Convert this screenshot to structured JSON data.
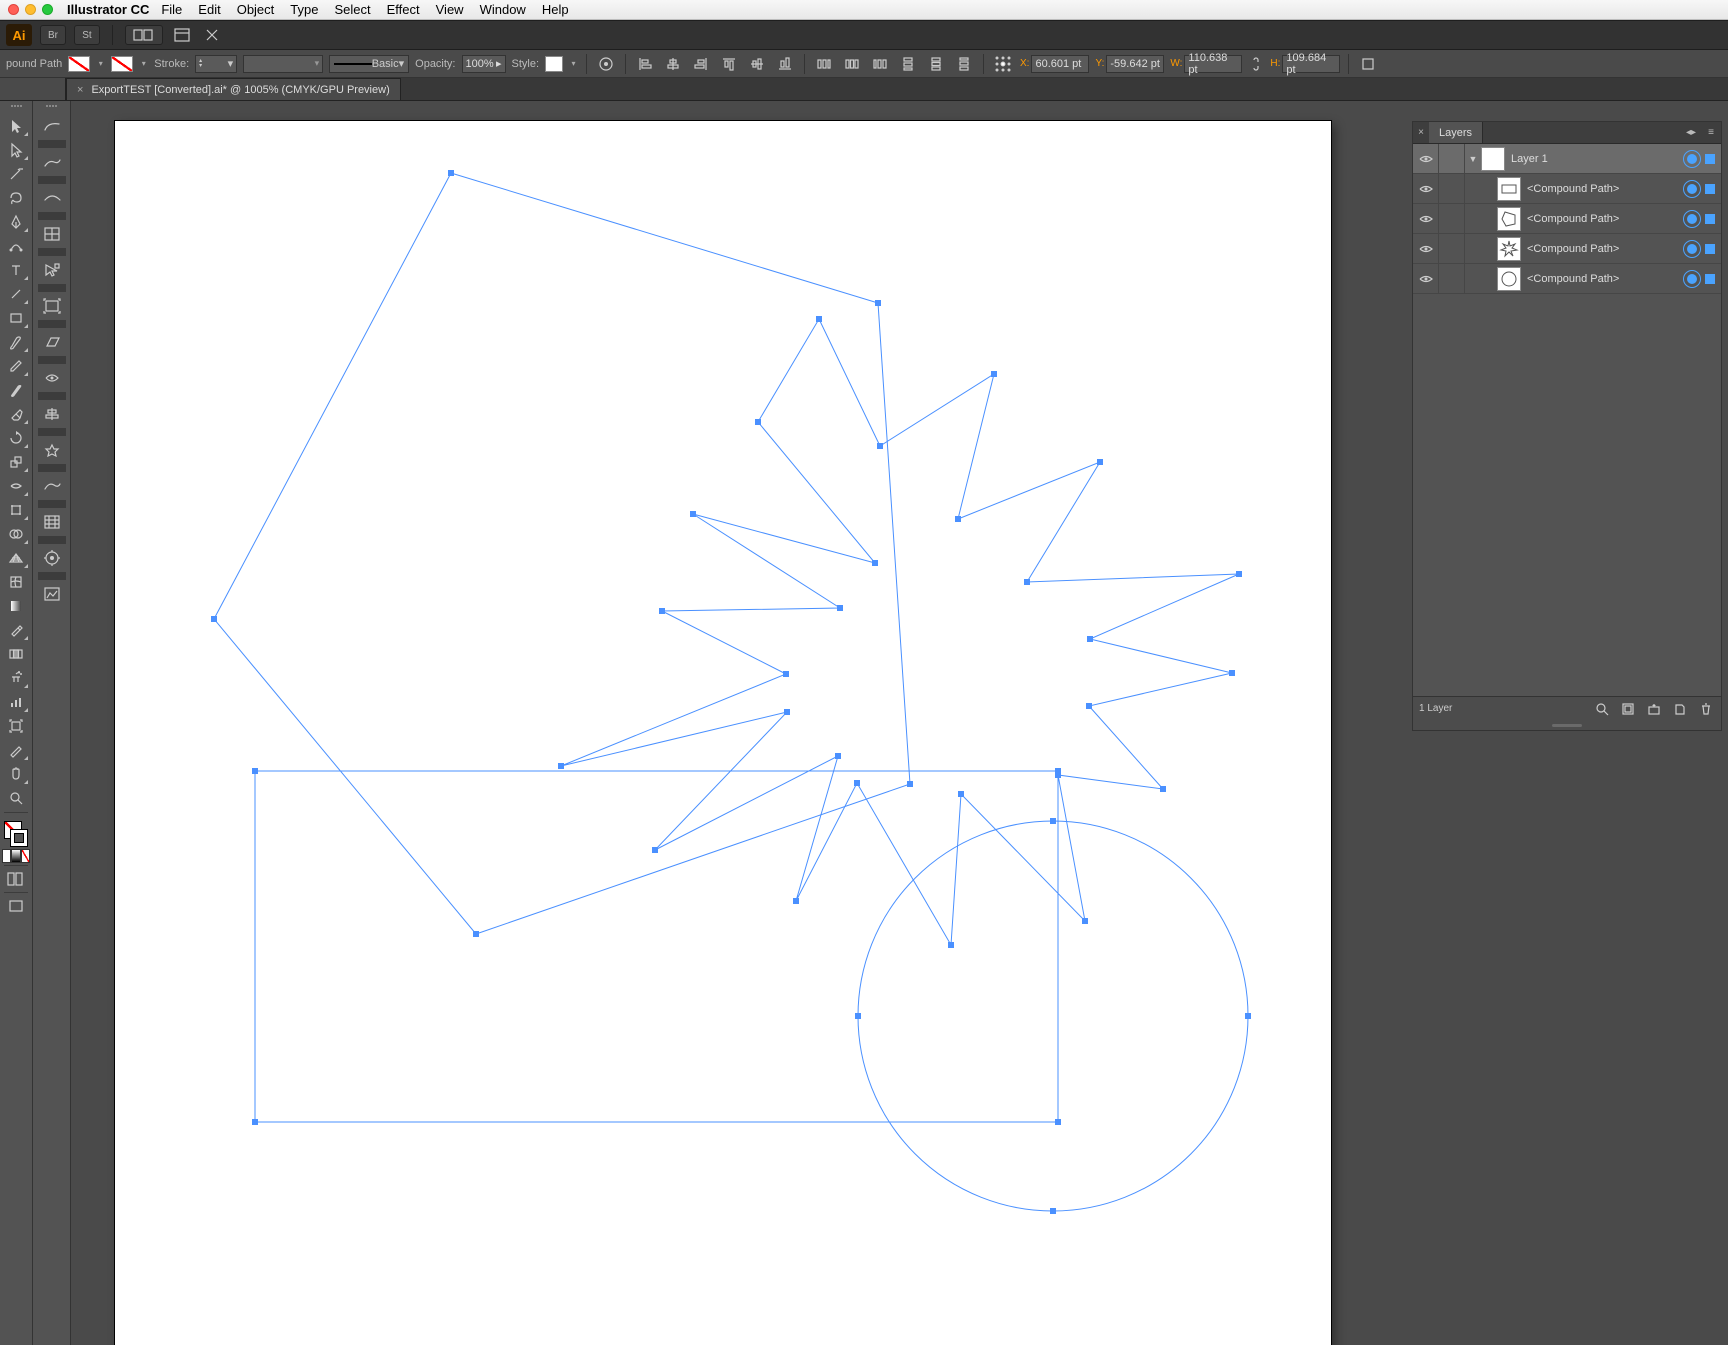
{
  "menubar": {
    "app": "Illustrator CC",
    "items": [
      "File",
      "Edit",
      "Object",
      "Type",
      "Select",
      "Effect",
      "View",
      "Window",
      "Help"
    ]
  },
  "appbar": {
    "br": "Br",
    "st": "St"
  },
  "options": {
    "selection_label": "pound Path",
    "stroke_label": "Stroke:",
    "stroke_weight": "",
    "brush_label": "Basic",
    "opacity_label": "Opacity:",
    "opacity_value": "100%",
    "style_label": "Style:",
    "x_label": "X:",
    "x_value": "60.601 pt",
    "y_label": "Y:",
    "y_value": "-59.642 pt",
    "w_label": "W:",
    "w_value": "110.638 pt",
    "h_label": "H:",
    "h_value": "109.684 pt"
  },
  "doc_tab": {
    "title": "ExportTEST [Converted].ai* @ 1005% (CMYK/GPU Preview)"
  },
  "layers_panel": {
    "title": "Layers",
    "layer_name": "Layer 1",
    "items": [
      {
        "name": "<Compound Path>",
        "shape": "rect"
      },
      {
        "name": "<Compound Path>",
        "shape": "penta"
      },
      {
        "name": "<Compound Path>",
        "shape": "star"
      },
      {
        "name": "<Compound Path>",
        "shape": "circle"
      }
    ],
    "footer_count": "1 Layer"
  }
}
